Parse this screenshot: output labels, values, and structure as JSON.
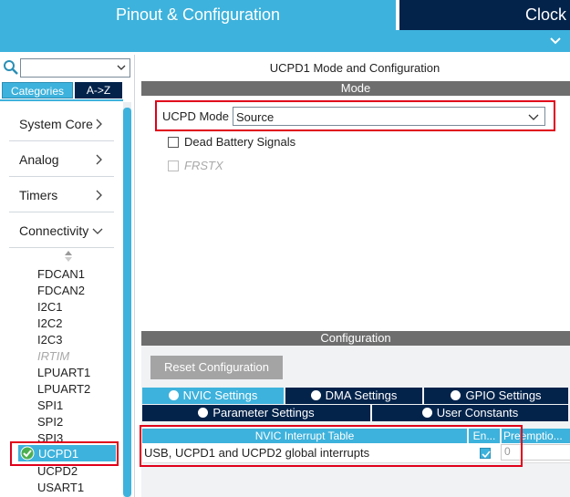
{
  "header": {
    "tab_pinout": "Pinout & Configuration",
    "tab_clock": "Clock"
  },
  "left": {
    "search_value": "",
    "tab_categories": "Categories",
    "tab_az": "A->Z",
    "categories": [
      {
        "label": "System Core"
      },
      {
        "label": "Analog"
      },
      {
        "label": "Timers"
      },
      {
        "label": "Connectivity"
      }
    ],
    "items": [
      "FDCAN1",
      "FDCAN2",
      "I2C1",
      "I2C2",
      "I2C3",
      "IRTIM",
      "LPUART1",
      "LPUART2",
      "SPI1",
      "SPI2",
      "SPI3",
      "UCPD1",
      "UCPD2",
      "USART1"
    ],
    "selected_item": "UCPD1"
  },
  "right": {
    "title": "UCPD1 Mode and Configuration",
    "mode_section": "Mode",
    "ucpd_mode_label": "UCPD Mode",
    "ucpd_mode_value": "Source",
    "dead_battery": "Dead Battery Signals",
    "frstx": "FRSTX",
    "config_section": "Configuration",
    "reset_button": "Reset Configuration",
    "tabs": {
      "nvic": "NVIC Settings",
      "dma": "DMA Settings",
      "gpio": "GPIO Settings",
      "param": "Parameter Settings",
      "user": "User Constants"
    },
    "table": {
      "col_table": "NVIC Interrupt Table",
      "col_en": "En...",
      "col_pre": "Preemptio...",
      "row_name": "USB, UCPD1 and UCPD2 global interrupts",
      "row_pre": "0"
    }
  },
  "colors": {
    "accent": "#3db2dc",
    "navy": "#03234b",
    "section_gray": "#6e6e6e",
    "highlight_red": "#e0001a"
  }
}
